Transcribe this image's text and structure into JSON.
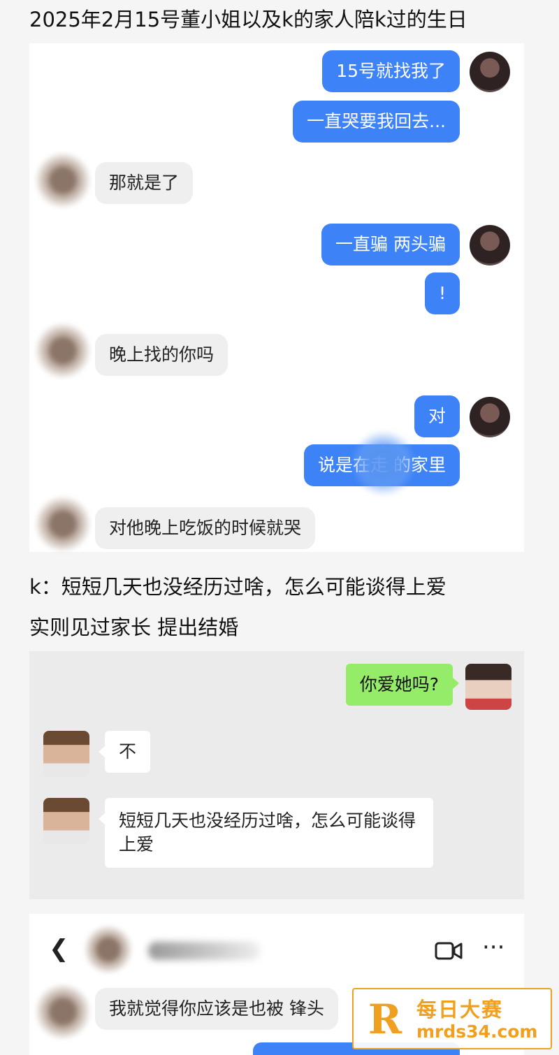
{
  "caption_top": "2025年2月15号董小姐以及k的家人陪k过的生日",
  "chat1": {
    "messages": [
      {
        "side": "right",
        "text": "15号就找我了"
      },
      {
        "side": "right",
        "text": "一直哭要我回去..."
      },
      {
        "side": "left",
        "text": "那就是了"
      },
      {
        "side": "right",
        "text": "一直骗 两头骗"
      },
      {
        "side": "right",
        "text": "!"
      },
      {
        "side": "left",
        "text": "晚上找的你吗"
      },
      {
        "side": "right",
        "text": "对"
      },
      {
        "side": "right",
        "text": "说是在走    的家里"
      },
      {
        "side": "left",
        "text": "对他晚上吃饭的时候就哭"
      }
    ]
  },
  "caption_mid_1": "k：短短几天也没经历过啥，怎么可能谈得上爱",
  "caption_mid_2": "实则见过家长 提出结婚",
  "chat2": {
    "messages": [
      {
        "side": "right",
        "text": "你爱她吗?"
      },
      {
        "side": "left",
        "text": "不"
      },
      {
        "side": "left",
        "text": "短短几天也没经历过啥，怎么可能谈得上爱"
      }
    ]
  },
  "chat3": {
    "back_icon": "chevron-left-icon",
    "video_icon": "video-camera-icon",
    "more_icon": "more-dots-icon",
    "message": "我就觉得你应该是也被   锋头"
  },
  "watermark": {
    "logo_letter": "R",
    "text_cn": "每日大赛",
    "url": "mrds34.com"
  },
  "colors": {
    "blue_bubble": "#3d82f6",
    "green_bubble": "#95ec69",
    "watermark": "#f0a020"
  }
}
